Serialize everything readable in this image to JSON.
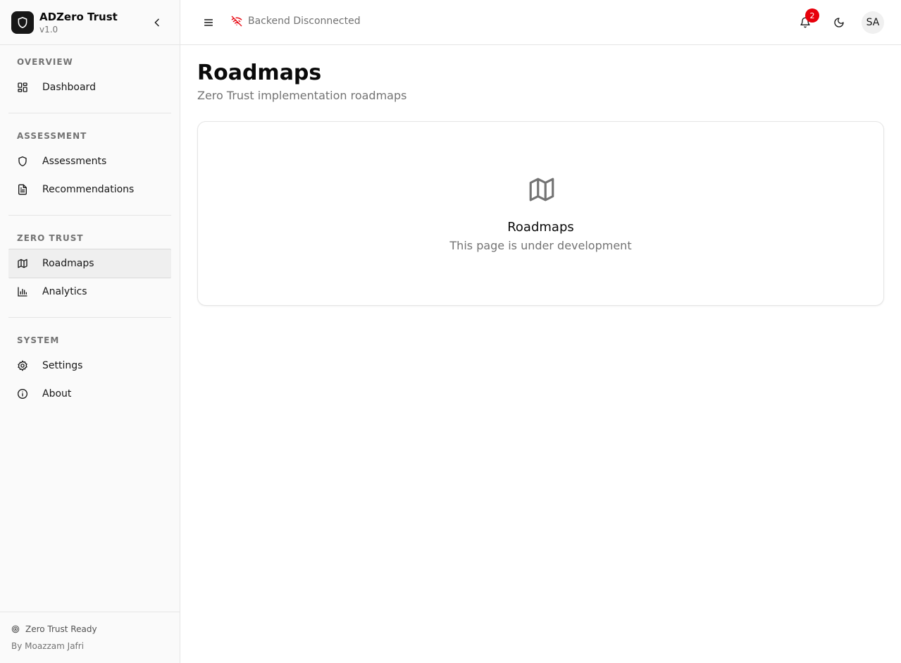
{
  "app": {
    "name": "ADZero Trust",
    "version": "v1.0",
    "logo_icon": "shield-icon"
  },
  "sidebar": {
    "collapse_icon": "chevron-left-icon",
    "sections": [
      {
        "label": "OVERVIEW",
        "items": [
          {
            "label": "Dashboard",
            "icon": "dashboard-icon",
            "active": false
          }
        ]
      },
      {
        "label": "ASSESSMENT",
        "items": [
          {
            "label": "Assessments",
            "icon": "shield-icon",
            "active": false
          },
          {
            "label": "Recommendations",
            "icon": "document-icon",
            "active": false
          }
        ]
      },
      {
        "label": "ZERO TRUST",
        "items": [
          {
            "label": "Roadmaps",
            "icon": "map-icon",
            "active": true
          },
          {
            "label": "Analytics",
            "icon": "bar-chart-icon",
            "active": false
          }
        ]
      },
      {
        "label": "SYSTEM",
        "items": [
          {
            "label": "Settings",
            "icon": "gear-icon",
            "active": false
          },
          {
            "label": "About",
            "icon": "info-icon",
            "active": false
          }
        ]
      }
    ],
    "footer": {
      "status": "Zero Trust Ready",
      "status_icon": "radar-icon",
      "author": "By Moazzam Jafri"
    }
  },
  "topbar": {
    "menu_icon": "hamburger-menu-icon",
    "backend_status": "Backend Disconnected",
    "backend_status_icon": "wifi-off-icon",
    "notifications_count": "2",
    "theme_icon": "moon-icon",
    "avatar_initials": "SA"
  },
  "page": {
    "title": "Roadmaps",
    "subtitle": "Zero Trust implementation roadmaps"
  },
  "placeholder": {
    "icon": "map-icon",
    "title": "Roadmaps",
    "text": "This page is under development"
  },
  "colors": {
    "badge": "#e7000b",
    "backend_status_icon": "#e7000b",
    "active_nav_bg": "#efefef",
    "sidebar_bg": "#fafafa"
  }
}
